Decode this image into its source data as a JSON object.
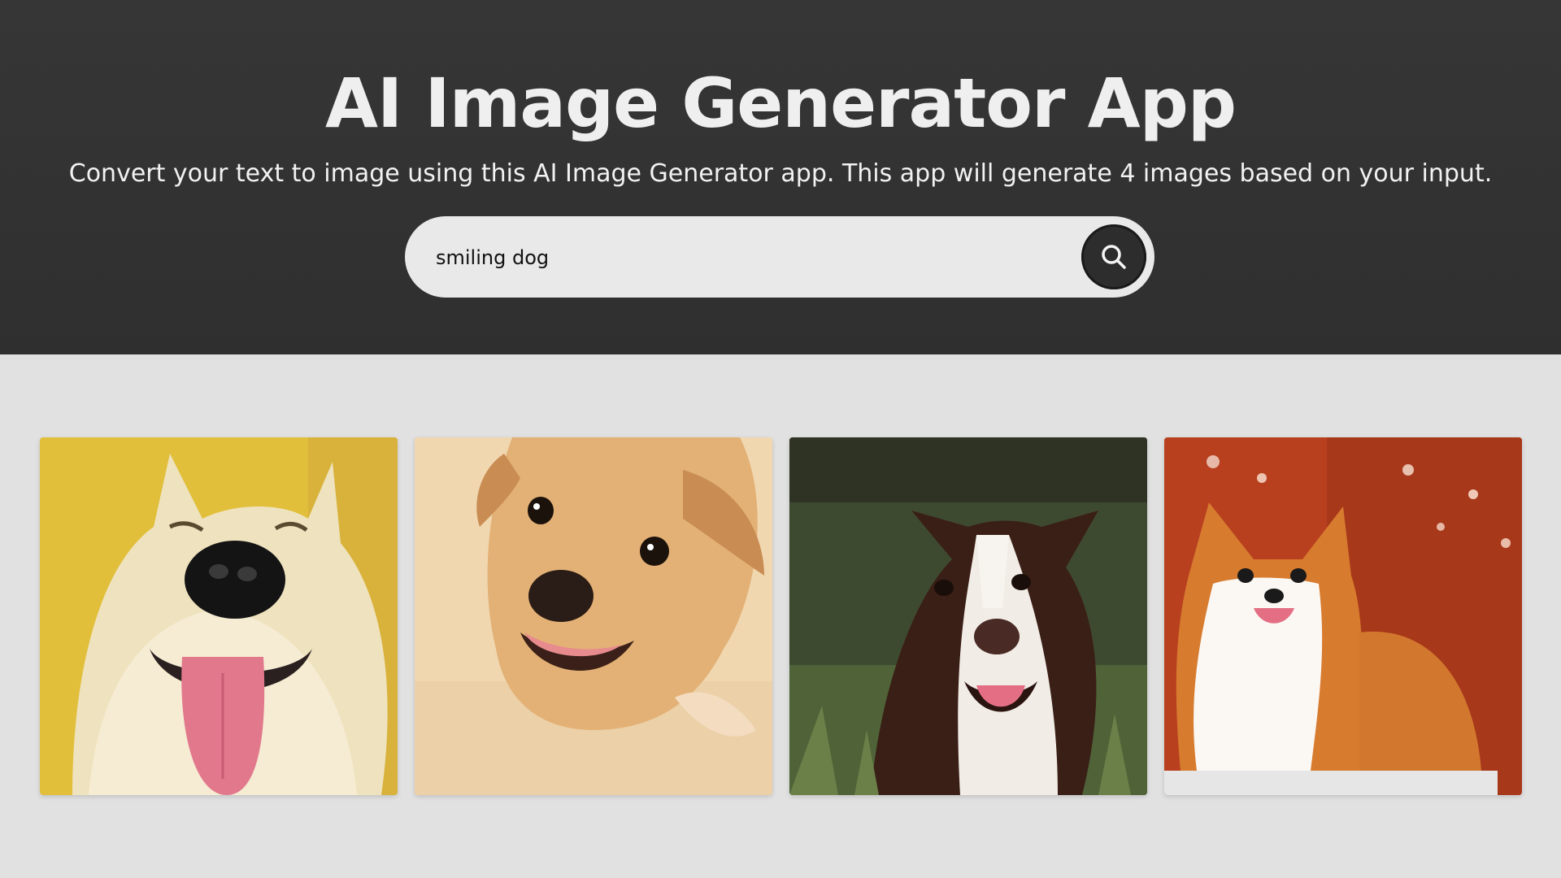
{
  "header": {
    "title": "AI Image Generator App",
    "subtitle": "Convert your text to image using this AI Image Generator app. This app will generate 4 images based on your input."
  },
  "search": {
    "value": "smiling dog",
    "button_icon": "search-icon"
  },
  "colors": {
    "header_bg": "#333333",
    "page_bg": "#e1e1e1",
    "search_bg": "#e9e9e9",
    "button_bg": "#2d2d2d"
  },
  "images": [
    {
      "subject": "fluffy dog with tongue out",
      "background": "#e3c33d"
    },
    {
      "subject": "tan puppy looking up",
      "background": "#f0d9b5"
    },
    {
      "subject": "brown and white dog on grass",
      "background": "#4a5a36"
    },
    {
      "subject": "corgi sitting",
      "background": "#b8401f"
    }
  ]
}
